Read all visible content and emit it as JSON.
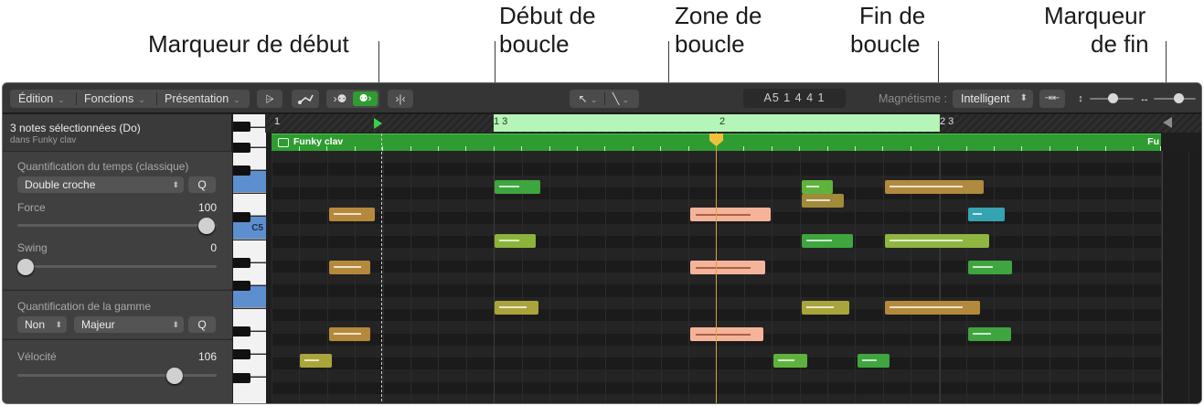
{
  "callouts": {
    "start_marker": "Marqueur de début",
    "loop_start_1": "Début de",
    "loop_start_2": "boucle",
    "loop_zone_1": "Zone de",
    "loop_zone_2": "boucle",
    "loop_end_1": "Fin de",
    "loop_end_2": "boucle",
    "end_marker_1": "Marqueur",
    "end_marker_2": "de fin"
  },
  "toolbar": {
    "menus": [
      "Édition",
      "Fonctions",
      "Présentation"
    ],
    "icons": [
      "quantize-icon",
      "midi-in-icon",
      "catch-playhead-icon",
      "link-icon",
      "collapse-icon",
      "pointer-tool-icon",
      "pencil-tool-icon"
    ],
    "position_display": "A5  1 4 4 1",
    "snap_label": "Magnétisme :",
    "snap_value": "Intelligent"
  },
  "inspector": {
    "title": "3 notes sélectionnées (Do)",
    "subtitle": "dans Funky clav",
    "time_quantize_label": "Quantification du temps (classique)",
    "time_quantize_value": "Double croche",
    "q_button": "Q",
    "strength_label": "Force",
    "strength_value": "100",
    "swing_label": "Swing",
    "swing_value": "0",
    "scale_quantize_label": "Quantification de la gamme",
    "scale_root": "Non",
    "scale_type": "Majeur",
    "velocity_label": "Vélocité",
    "velocity_value": "106",
    "slider_levels": {
      "strength": 1.0,
      "swing": 0.0,
      "velocity": 0.83
    }
  },
  "keyboard": {
    "octave_label": "C5"
  },
  "ruler": {
    "bar_1": "1",
    "bar_1_3": "1 3",
    "bar_2": "2",
    "bar_2_3": "2 3"
  },
  "region": {
    "name": "Funky clav",
    "end_label": "Fu"
  },
  "colors": {
    "loop": "#b5f5b7",
    "region": "#2f9c32",
    "selected_note": "#f5b49a",
    "playhead": "#f0c23a"
  }
}
